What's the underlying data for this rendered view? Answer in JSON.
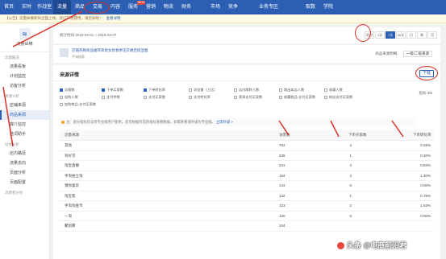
{
  "topnav": {
    "items": [
      {
        "label": "首页"
      },
      {
        "label": "实时"
      },
      {
        "label": "作战室"
      },
      {
        "label": "流量"
      },
      {
        "label": "商品"
      },
      {
        "label": "交易"
      },
      {
        "label": "内容"
      },
      {
        "label": "服务"
      },
      {
        "label": "营销"
      },
      {
        "label": "物流"
      },
      {
        "label": "财务"
      },
      {
        "label": "市场"
      },
      {
        "label": "竞争"
      },
      {
        "label": "业务专区"
      },
      {
        "label": "取数"
      },
      {
        "label": "学院"
      }
    ],
    "badge": "NEW"
  },
  "notice": {
    "text": "【公告】流量纵横即将全面上线，现已开放使用，请您知晓！",
    "link": "查看详情"
  },
  "sidebar": {
    "logo_text": "流量纵横",
    "groups": [
      {
        "title": "流量概况",
        "items": [
          "流量看板",
          "计划监控",
          "访客分析"
        ]
      },
      {
        "title": "来源分析",
        "items": [
          "店铺来源",
          "商品来源",
          "媒介监控",
          "选词助手"
        ]
      },
      {
        "title": "动线分析",
        "items": [
          "店内路径",
          "流量去向",
          "页面分析",
          "页面配置"
        ]
      },
      {
        "title": "消费者分析",
        "items": []
      }
    ],
    "active": "商品来源"
  },
  "datebar": {
    "range": "统计时间 2019-03-01 ~ 2019-03-07",
    "buttons": [
      "实时",
      "1天",
      "7天",
      "30天",
      "日",
      "周",
      "月"
    ],
    "active_button": "7天"
  },
  "infobar": {
    "title": "店铺热销商品推荐新款女装春季连衣裙百搭显瘦",
    "sub": "手淘搜索",
    "right_label": "商品来源明细：",
    "select_value": "一级/二级来源"
  },
  "panel": {
    "title": "来源详情",
    "download": "下载",
    "pager": "指标 3/5",
    "metrics": [
      {
        "label": "访客数",
        "checked": true
      },
      {
        "label": "下单买家数",
        "checked": true
      },
      {
        "label": "下单转化率",
        "checked": true
      },
      {
        "label": "浏览量（占比）",
        "checked": false
      },
      {
        "label": "店内跳转人数",
        "checked": false
      },
      {
        "label": "跳出本店人数",
        "checked": false
      },
      {
        "label": "收藏人数",
        "checked": false
      },
      {
        "label": "加购人数",
        "checked": false
      },
      {
        "label": "支付件数",
        "checked": false
      },
      {
        "label": "支付买家数",
        "checked": false
      },
      {
        "label": "支付转化率",
        "checked": false
      },
      {
        "label": "直接支付买家数",
        "checked": false
      },
      {
        "label": "收藏商品-支付买家数",
        "checked": false
      },
      {
        "label": "粉丝支付买家数",
        "checked": false
      },
      {
        "label": "加购商品-支付买家数",
        "checked": false
      }
    ],
    "tip": "注：部分指标仅支持专业版用户使用，您可根据所选的指标查看数据，如需查看请升级为专业版。",
    "tip_link": "立即升级 >",
    "columns": [
      "流量来源",
      "访客数",
      "下单买家数",
      "下单转化率"
    ],
    "rows": [
      {
        "source": "其他",
        "visitors": "762",
        "buyers": "2",
        "rate": "0.26%"
      },
      {
        "source": "有好货",
        "visitors": "335",
        "buyers": "1",
        "rate": "0.30%"
      },
      {
        "source": "淘宝直播",
        "visitors": "241",
        "buyers": "2",
        "rate": "0.83%"
      },
      {
        "source": "手淘拍立淘",
        "visitors": "154",
        "buyers": "2",
        "rate": "1.30%"
      },
      {
        "source": "猜你喜欢",
        "visitors": "144",
        "buyers": "0",
        "rate": "0.00%"
      },
      {
        "source": "淘宝客",
        "visitors": "132",
        "buyers": "1",
        "rate": "0.76%"
      },
      {
        "source": "手淘淘金币",
        "visitors": "123",
        "buyers": "2",
        "rate": "1.63%"
      },
      {
        "source": "一淘",
        "visitors": "120",
        "buyers": "0",
        "rate": "0.00%"
      },
      {
        "source": "聚划算",
        "visitors": "104",
        "buyers": "",
        "rate": ""
      }
    ]
  },
  "watermark": "头条 @电商前沿君",
  "colors": {
    "brand": "#2c5fb3",
    "annotation": "#d93025"
  }
}
